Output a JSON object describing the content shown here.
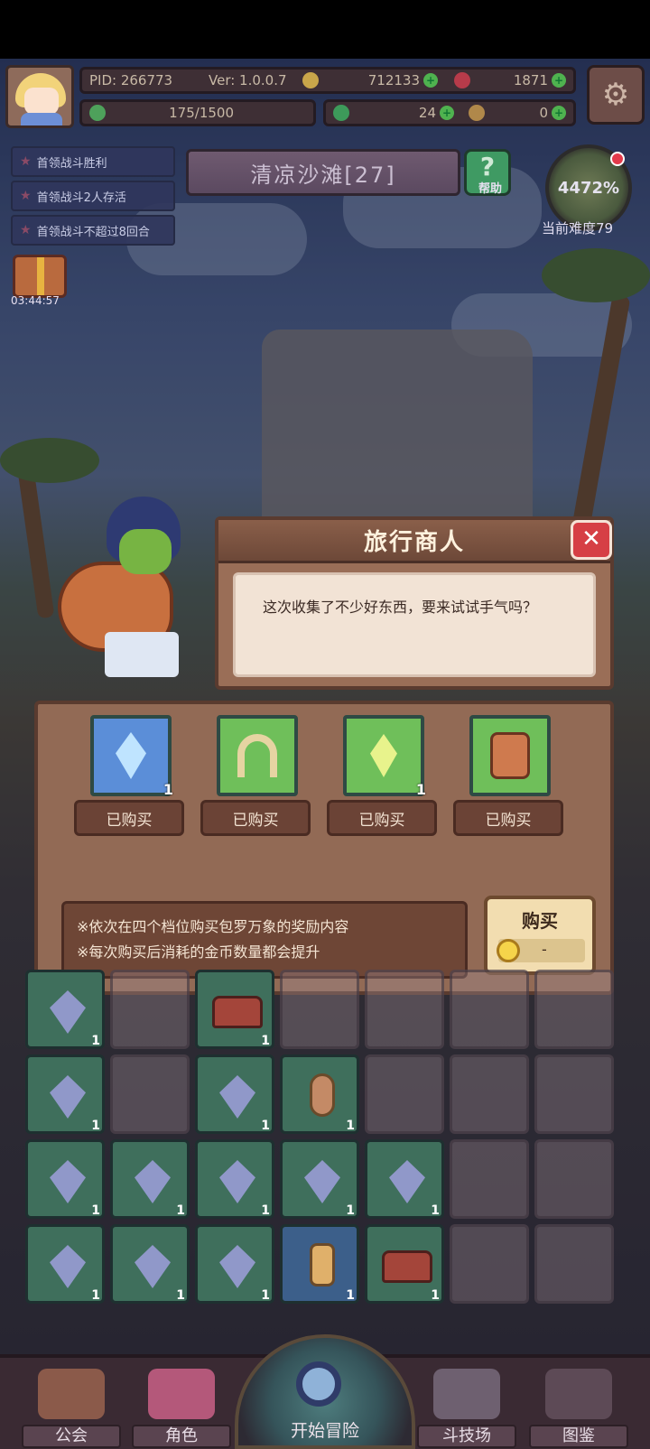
{
  "hud": {
    "pid": "PID: 266773",
    "version": "Ver: 1.0.0.7",
    "gold": "712133",
    "apples": "1871",
    "energy": "175/1500",
    "clover": "24",
    "item": "0"
  },
  "quests": [
    "首领战斗胜利",
    "首领战斗2人存活",
    "首领战斗不超过8回合"
  ],
  "gift_timer": "03:44:57",
  "stage": {
    "name": "清凉沙滩[27]",
    "help_label": "帮助"
  },
  "difficulty": {
    "percent": "4472%",
    "label": "当前难度79"
  },
  "dialog": {
    "title": "旅行商人",
    "message": "这次收集了不少好东西，要来试试手气吗？"
  },
  "shop": {
    "slots": [
      {
        "icon": "blue-crystal-icon",
        "count": "1",
        "status": "已购买",
        "bg": "#5b8ed8"
      },
      {
        "icon": "horseshoe-icon",
        "count": "",
        "status": "已购买",
        "bg": "#6fbf5a"
      },
      {
        "icon": "green-crystal-icon",
        "count": "1",
        "status": "已购买",
        "bg": "#6fbf5a"
      },
      {
        "icon": "scroll-icon",
        "count": "",
        "status": "已购买",
        "bg": "#6fbf5a"
      }
    ],
    "info_lines": [
      "※依次在四个档位购买包罗万象的奖励内容",
      "※每次购买后消耗的金币数量都会提升"
    ],
    "buy_label": "购买",
    "price": "-"
  },
  "nav": {
    "guild": "公会",
    "role": "角色",
    "start": "开始冒险",
    "arena": "斗技场",
    "codex": "图鉴"
  },
  "inventory_counts": {
    "one": "1"
  }
}
